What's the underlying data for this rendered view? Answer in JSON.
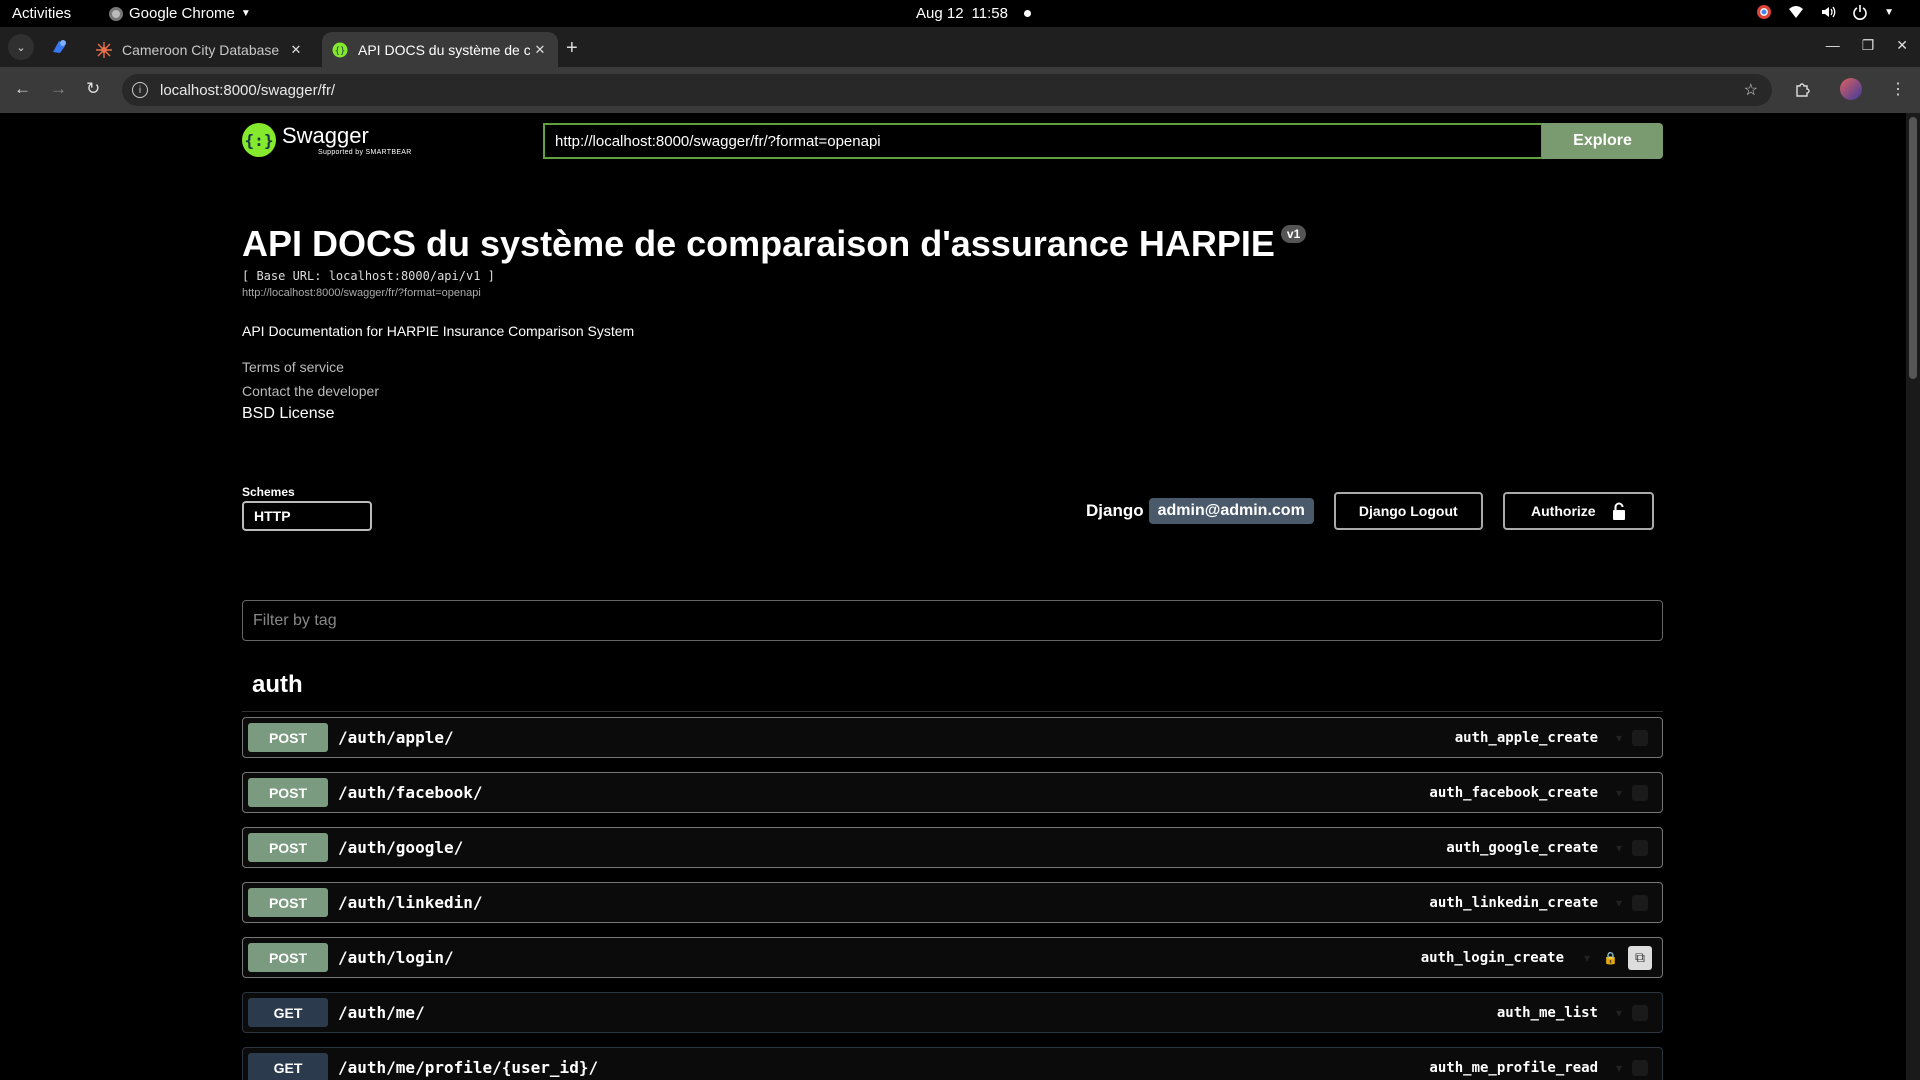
{
  "os": {
    "activities": "Activities",
    "app_name": "Google Chrome",
    "date": "Aug 12",
    "time": "11:58"
  },
  "browser": {
    "tabs": [
      {
        "title": "Cameroon City Database",
        "active": false
      },
      {
        "title": "API DOCS du système de comparaison d'assurance HARPIE",
        "active": true
      }
    ],
    "url": "localhost:8000/swagger/fr/"
  },
  "swagger": {
    "logo_text": "Swagger",
    "logo_sub": "Supported by SMARTBEAR",
    "spec_url_input": "http://localhost:8000/swagger/fr/?format=openapi",
    "explore_label": "Explore",
    "title": "API DOCS du système de comparaison d'assurance HARPIE",
    "version": "v1",
    "base_url": "[ Base URL: localhost:8000/api/v1 ]",
    "spec_link": "http://localhost:8000/swagger/fr/?format=openapi",
    "description": "API Documentation for HARPIE Insurance Comparison System",
    "terms": "Terms of service",
    "contact": "Contact the developer",
    "license": "BSD License",
    "schemes_label": "Schemes",
    "scheme_selected": "HTTP",
    "django_label": "Django",
    "user_email": "admin@admin.com",
    "logout_label": "Django Logout",
    "authorize_label": "Authorize",
    "filter_placeholder": "Filter by tag",
    "tag": "auth",
    "operations": [
      {
        "method": "POST",
        "path": "/auth/apple/",
        "id": "auth_apple_create"
      },
      {
        "method": "POST",
        "path": "/auth/facebook/",
        "id": "auth_facebook_create"
      },
      {
        "method": "POST",
        "path": "/auth/google/",
        "id": "auth_google_create"
      },
      {
        "method": "POST",
        "path": "/auth/linkedin/",
        "id": "auth_linkedin_create"
      },
      {
        "method": "POST",
        "path": "/auth/login/",
        "id": "auth_login_create"
      },
      {
        "method": "GET",
        "path": "/auth/me/",
        "id": "auth_me_list"
      },
      {
        "method": "GET",
        "path": "/auth/me/profile/{user_id}/",
        "id": "auth_me_profile_read"
      }
    ]
  },
  "colors": {
    "post": "#7a9b7f",
    "get": "#2b3a4c",
    "swagger_green": "#85ea2d"
  }
}
